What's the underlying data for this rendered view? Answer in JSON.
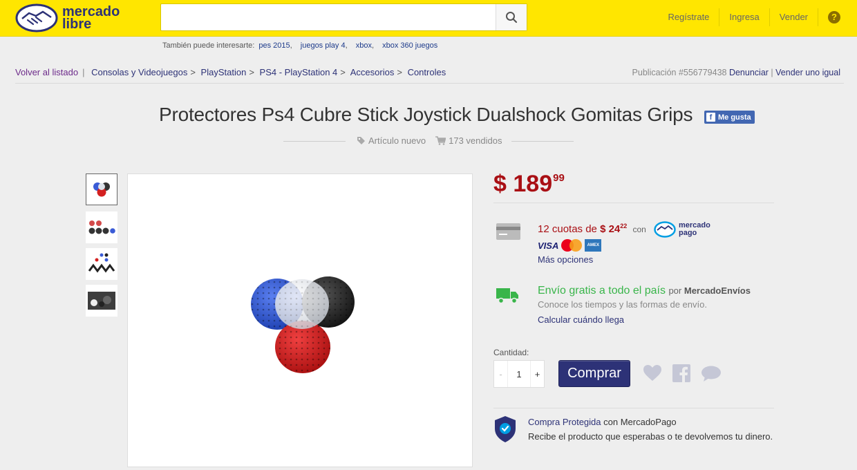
{
  "header": {
    "logo_text": "mercado\nlibre",
    "search": {
      "value": "",
      "placeholder": ""
    },
    "nav": [
      "Regístrate",
      "Ingresa",
      "Vender"
    ],
    "help_icon": "?"
  },
  "suggestions": {
    "label": "También puede interesarte:",
    "items": [
      "pes 2015",
      "juegos play 4",
      "xbox",
      "xbox 360 juegos"
    ]
  },
  "breadcrumb": {
    "back": "Volver al listado",
    "items": [
      "Consolas y Videojuegos",
      "PlayStation",
      "PS4 - PlayStation 4",
      "Accesorios",
      "Controles"
    ]
  },
  "publication": {
    "id_text": "Publicación #556779438",
    "report": "Denunciar",
    "sell_same": "Vender uno igual"
  },
  "product": {
    "title": "Protectores Ps4 Cubre Stick Joystick Dualshock Gomitas Grips",
    "fb_like": "Me gusta",
    "condition": "Artículo nuevo",
    "sold": "173 vendidos",
    "price_currency": "$",
    "price_int": "189",
    "price_cents": "99"
  },
  "payment": {
    "installments": "12 cuotas de",
    "installment_currency": "$",
    "installment_int": "24",
    "installment_cents": "22",
    "with": "con",
    "mp_logo_text": "mercado pago",
    "card_visa": "VISA",
    "card_amex": "AMEX",
    "more_options": "Más opciones"
  },
  "shipping": {
    "title": "Envío gratis a todo el país",
    "by": "por",
    "provider": "MercadoEnvíos",
    "subtitle": "Conoce los tiempos y las formas de envío.",
    "calc_link": "Calcular cuándo llega"
  },
  "purchase": {
    "quantity_label": "Cantidad:",
    "minus": "-",
    "quantity": "1",
    "plus": "+",
    "buy_label": "Comprar"
  },
  "protection": {
    "title_link": "Compra Protegida",
    "title_rest": "con MercadoPago",
    "subtitle": "Recibe el producto que esperabas o te devolvemos tu dinero."
  },
  "colors": {
    "header_bg": "#ffe600",
    "brand_blue": "#2d3277",
    "price_red": "#a90f14",
    "shipping_green": "#39b54a"
  }
}
